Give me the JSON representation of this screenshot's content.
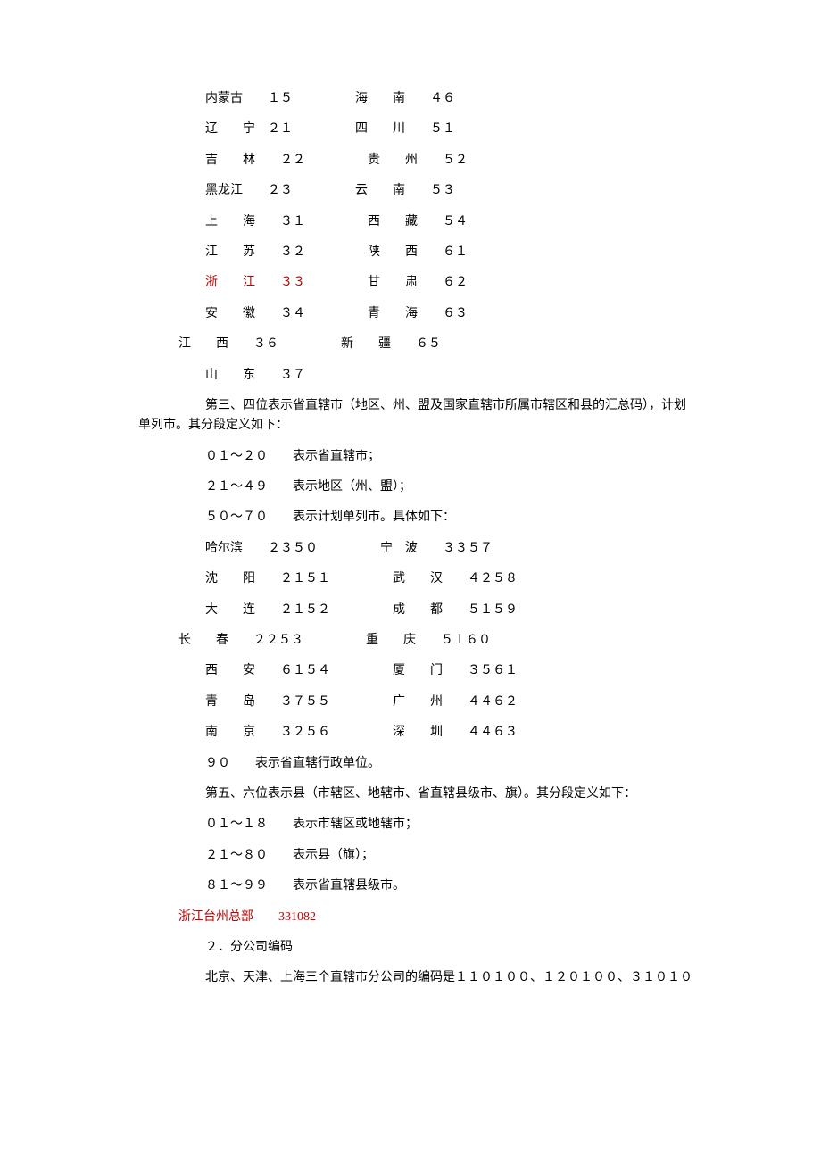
{
  "provinces": [
    {
      "left": "内蒙古　　１５",
      "right": "海　　南　　４６",
      "outdent": false,
      "left_red": false
    },
    {
      "left": "辽　　宁　２１",
      "right": "四　　川　　５１",
      "outdent": false,
      "left_red": false
    },
    {
      "left": "吉　　林　　２２",
      "right": "贵　　州　　５２",
      "outdent": false,
      "left_red": false
    },
    {
      "left": "黑龙江　　２３",
      "right": "云　　南　　５３",
      "outdent": false,
      "left_red": false
    },
    {
      "left": "上　　海　　３１",
      "right": "西　　藏　　５４",
      "outdent": false,
      "left_red": false
    },
    {
      "left": "江　　苏　　３２",
      "right": "陕　　西　　６１",
      "outdent": false,
      "left_red": false
    },
    {
      "left": "浙　　江　　３３",
      "right": "甘　　肃　　６２",
      "outdent": false,
      "left_red": true
    },
    {
      "left": "安　　徽　　３４",
      "right": "青　　海　　６３",
      "outdent": false,
      "left_red": false
    },
    {
      "left": "江　　西　　３６",
      "right": "新　　疆　　６５",
      "outdent": true,
      "left_red": false
    },
    {
      "left": "山　　东　　３７",
      "right": "",
      "outdent": false,
      "left_red": false
    }
  ],
  "para1_line1": "第三、四位表示省直辖市（地区、州、盟及国家直辖市所属市辖区和县的汇总码），计划",
  "para1_line2": "单列市。其分段定义如下：",
  "ranges1": [
    "０１～２０　　表示省直辖市；",
    "２１～４９　　表示地区（州、盟）；",
    "５０～７０　　表示计划单列市。具体如下："
  ],
  "cities": [
    {
      "left": "哈尔滨　　２３５０",
      "right": "宁　波　　３３５７",
      "outdent": false
    },
    {
      "left": "沈　　阳　　２１５１",
      "right": "武　　汉　　４２５８",
      "outdent": false
    },
    {
      "left": "大　　连　　２１５２",
      "right": "成　　都　　５１５９",
      "outdent": false
    },
    {
      "left": "长　　春　　２２５３",
      "right": "重　　庆　　５１６０",
      "outdent": true
    },
    {
      "left": "西　　安　　６１５４",
      "right": "厦　　门　　３５６１",
      "outdent": false
    },
    {
      "left": "青　　岛　　３７５５",
      "right": "广　　州　　４４６２",
      "outdent": false
    },
    {
      "left": "南　　京　　３２５６",
      "right": "深　　圳　　４４６３",
      "outdent": false
    }
  ],
  "line_90": "９０　　表示省直辖行政单位。",
  "para2": "第五、六位表示县（市辖区、地辖市、省直辖县级市、旗）。其分段定义如下：",
  "ranges2": [
    "０１～１８　　表示市辖区或地辖市；",
    "２１～８０　　表示县（旗）；",
    "８１～９９　　表示省直辖县级市。"
  ],
  "red_zhejiang": "浙江台州总部　　331082",
  "section2_title": "２．分公司编码",
  "section2_body": "北京、天津、上海三个直辖市分公司的编码是１１０１００、１２０１００、３１０１０"
}
